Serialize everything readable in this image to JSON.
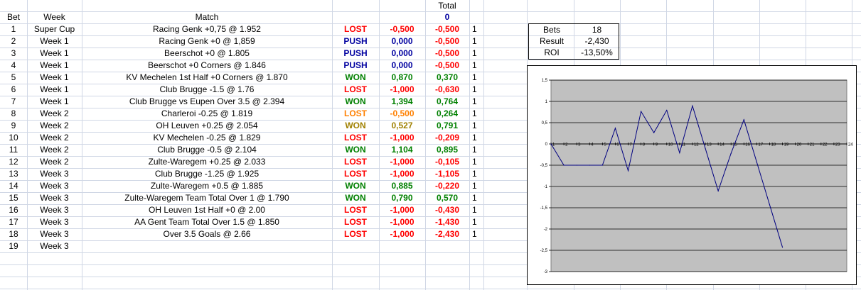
{
  "header": {
    "bet": "Bet",
    "week": "Week",
    "match": "Match",
    "total_label": "Total",
    "total_value": "0"
  },
  "colors": {
    "LOST": "#ff0000",
    "PUSH": "#0000a0",
    "WON": "#008000",
    "LOST_HALF": "#ff8000",
    "WON_HALF": "#a08000",
    "total_header": "#0000a0"
  },
  "rows": [
    {
      "bet": "1",
      "week": "Super Cup",
      "match": "Racing Genk +0,75 @ 1.952",
      "result": "LOST",
      "tone": "LOST",
      "profit": "-0,500",
      "ptone": "LOST",
      "cum": "-0,500",
      "ctone": "LOST",
      "n": "1"
    },
    {
      "bet": "2",
      "week": "Week 1",
      "match": "Racing Genk +0 @ 1,859",
      "result": "PUSH",
      "tone": "PUSH",
      "profit": "0,000",
      "ptone": "PUSH",
      "cum": "-0,500",
      "ctone": "LOST",
      "n": "1"
    },
    {
      "bet": "3",
      "week": "Week 1",
      "match": "Beerschot +0 @ 1.805",
      "result": "PUSH",
      "tone": "PUSH",
      "profit": "0,000",
      "ptone": "PUSH",
      "cum": "-0,500",
      "ctone": "LOST",
      "n": "1"
    },
    {
      "bet": "4",
      "week": "Week 1",
      "match": "Beerschot +0 Corners @ 1.846",
      "result": "PUSH",
      "tone": "PUSH",
      "profit": "0,000",
      "ptone": "PUSH",
      "cum": "-0,500",
      "ctone": "LOST",
      "n": "1"
    },
    {
      "bet": "5",
      "week": "Week 1",
      "match": "KV Mechelen 1st Half +0 Corners @ 1.870",
      "result": "WON",
      "tone": "WON",
      "profit": "0,870",
      "ptone": "WON",
      "cum": "0,370",
      "ctone": "WON",
      "n": "1"
    },
    {
      "bet": "6",
      "week": "Week 1",
      "match": "Club Brugge -1.5 @ 1.76",
      "result": "LOST",
      "tone": "LOST",
      "profit": "-1,000",
      "ptone": "LOST",
      "cum": "-0,630",
      "ctone": "LOST",
      "n": "1"
    },
    {
      "bet": "7",
      "week": "Week 1",
      "match": "Club Brugge vs Eupen Over 3.5 @ 2.394",
      "result": "WON",
      "tone": "WON",
      "profit": "1,394",
      "ptone": "WON",
      "cum": "0,764",
      "ctone": "WON",
      "n": "1"
    },
    {
      "bet": "8",
      "week": "Week 2",
      "match": "Charleroi -0.25 @ 1.819",
      "result": "LOST",
      "tone": "LOST_HALF",
      "profit": "-0,500",
      "ptone": "LOST_HALF",
      "cum": "0,264",
      "ctone": "WON",
      "n": "1"
    },
    {
      "bet": "9",
      "week": "Week 2",
      "match": "OH Leuven +0.25 @ 2.054",
      "result": "WON",
      "tone": "WON_HALF",
      "profit": "0,527",
      "ptone": "WON_HALF",
      "cum": "0,791",
      "ctone": "WON",
      "n": "1"
    },
    {
      "bet": "10",
      "week": "Week 2",
      "match": "KV Mechelen -0.25 @ 1.829",
      "result": "LOST",
      "tone": "LOST",
      "profit": "-1,000",
      "ptone": "LOST",
      "cum": "-0,209",
      "ctone": "LOST",
      "n": "1"
    },
    {
      "bet": "11",
      "week": "Week 2",
      "match": "Club Brugge -0.5 @ 2.104",
      "result": "WON",
      "tone": "WON",
      "profit": "1,104",
      "ptone": "WON",
      "cum": "0,895",
      "ctone": "WON",
      "n": "1"
    },
    {
      "bet": "12",
      "week": "Week 2",
      "match": "Zulte-Waregem +0.25 @ 2.033",
      "result": "LOST",
      "tone": "LOST",
      "profit": "-1,000",
      "ptone": "LOST",
      "cum": "-0,105",
      "ctone": "LOST",
      "n": "1"
    },
    {
      "bet": "13",
      "week": "Week 3",
      "match": "Club Brugge -1.25 @ 1.925",
      "result": "LOST",
      "tone": "LOST",
      "profit": "-1,000",
      "ptone": "LOST",
      "cum": "-1,105",
      "ctone": "LOST",
      "n": "1"
    },
    {
      "bet": "14",
      "week": "Week 3",
      "match": "Zulte-Waregem +0.5 @ 1.885",
      "result": "WON",
      "tone": "WON",
      "profit": "0,885",
      "ptone": "WON",
      "cum": "-0,220",
      "ctone": "LOST",
      "n": "1"
    },
    {
      "bet": "15",
      "week": "Week 3",
      "match": "Zulte-Waregem Team Total Over 1 @ 1.790",
      "result": "WON",
      "tone": "WON",
      "profit": "0,790",
      "ptone": "WON",
      "cum": "0,570",
      "ctone": "WON",
      "n": "1"
    },
    {
      "bet": "16",
      "week": "Week 3",
      "match": "OH Leuven 1st Half +0 @ 2.00",
      "result": "LOST",
      "tone": "LOST",
      "profit": "-1,000",
      "ptone": "LOST",
      "cum": "-0,430",
      "ctone": "LOST",
      "n": "1"
    },
    {
      "bet": "17",
      "week": "Week 3",
      "match": "AA Gent Team Total Over 1.5 @ 1.850",
      "result": "LOST",
      "tone": "LOST",
      "profit": "-1,000",
      "ptone": "LOST",
      "cum": "-1,430",
      "ctone": "LOST",
      "n": "1"
    },
    {
      "bet": "18",
      "week": "Week 3",
      "match": "Over 3.5 Goals @ 2.66",
      "result": "LOST",
      "tone": "LOST",
      "profit": "-1,000",
      "ptone": "LOST",
      "cum": "-2,430",
      "ctone": "LOST",
      "n": "1"
    },
    {
      "bet": "19",
      "week": "Week 3",
      "match": "",
      "result": "",
      "tone": "LOST",
      "profit": "",
      "ptone": "LOST",
      "cum": "",
      "ctone": "LOST",
      "n": ""
    }
  ],
  "summary": {
    "bets_label": "Bets",
    "bets_value": "18",
    "result_label": "Result",
    "result_value": "-2,430",
    "roi_label": "ROI",
    "roi_value": "-13,50%"
  },
  "chart_data": {
    "type": "line",
    "x": [
      1,
      2,
      3,
      4,
      5,
      6,
      7,
      8,
      9,
      10,
      11,
      12,
      13,
      14,
      15,
      16,
      17,
      18,
      19
    ],
    "y": [
      0,
      -0.5,
      -0.5,
      -0.5,
      -0.5,
      0.37,
      -0.63,
      0.764,
      0.264,
      0.791,
      -0.209,
      0.895,
      -0.105,
      -1.105,
      -0.22,
      0.57,
      -0.43,
      -1.43,
      -2.43
    ],
    "xticks": [
      "1",
      "2",
      "3",
      "4",
      "5",
      "6",
      "7",
      "8",
      "9",
      "10",
      "11",
      "12",
      "13",
      "14",
      "15",
      "16",
      "17",
      "18",
      "19",
      "20",
      "21",
      "22",
      "23",
      "24"
    ],
    "yticks": [
      "1,5",
      "1",
      "0,5",
      "0",
      "-0,5",
      "-1",
      "-1,5",
      "-2",
      "-2,5",
      "-3"
    ],
    "ylim": [
      -3,
      1.5
    ],
    "xlim": [
      1,
      24
    ],
    "grid": true,
    "line_color": "#000080",
    "plot_bg": "#c0c0c0"
  }
}
